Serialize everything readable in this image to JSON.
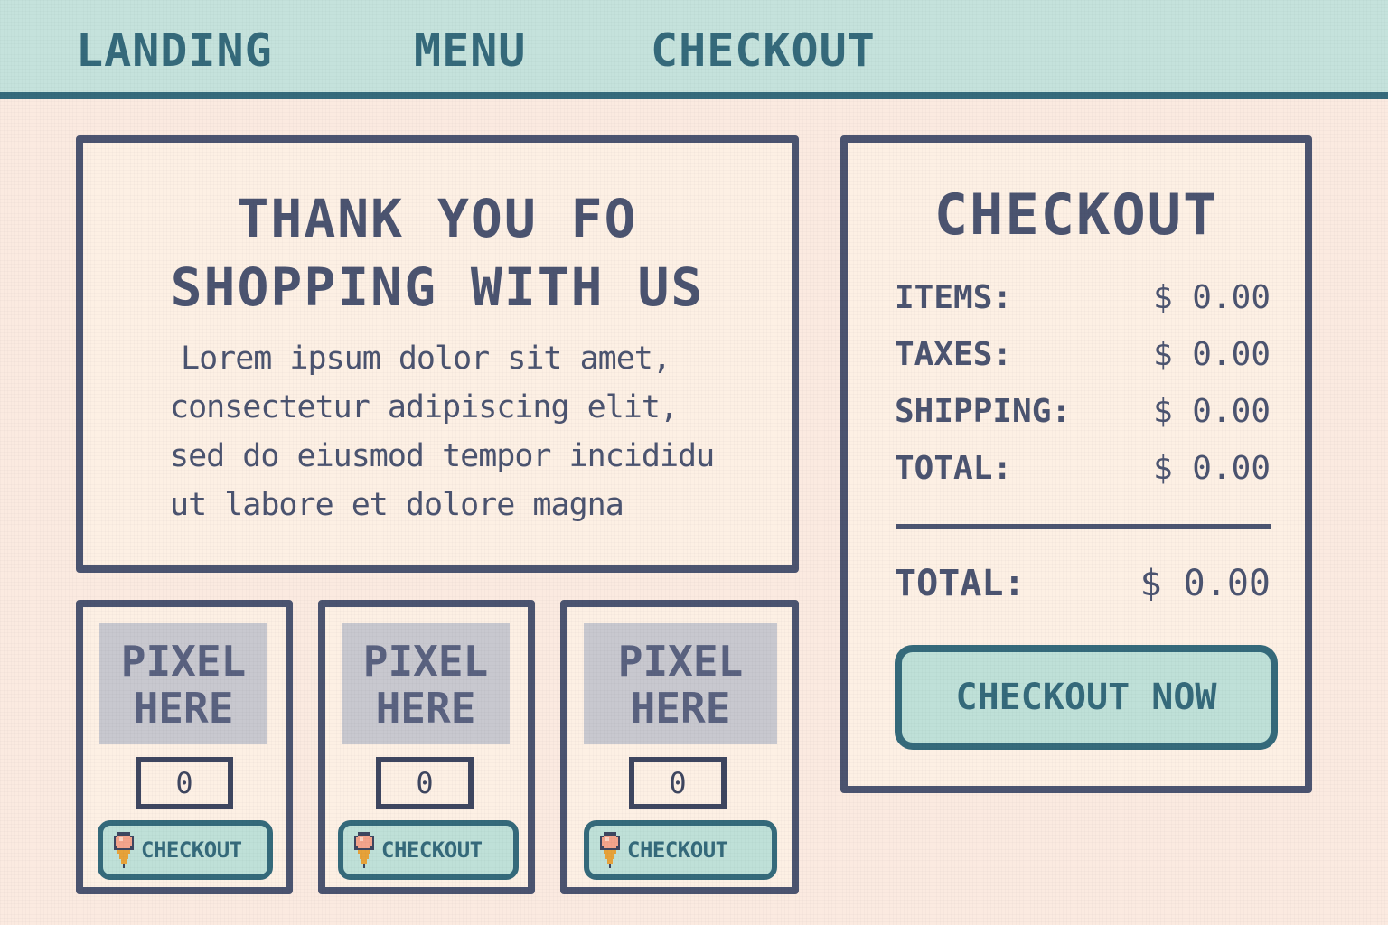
{
  "nav": {
    "items": [
      {
        "label": "LANDING"
      },
      {
        "label": "MENU"
      },
      {
        "label": "CHECKOUT"
      }
    ]
  },
  "thanks": {
    "title_line1": "THANK YOU FO",
    "title_line2": "SHOPPING WITH US",
    "body_lines": [
      "Lorem ipsum dolor sit amet,",
      "consectetur adipiscing elit,",
      "sed do eiusmod tempor incididu",
      "ut labore et dolore magna"
    ]
  },
  "products": [
    {
      "placeholder_line1": "PIXEL",
      "placeholder_line2": "HERE",
      "quantity": "0",
      "button_label": "CHECKOUT",
      "icon": "ice-cream-icon"
    },
    {
      "placeholder_line1": "PIXEL",
      "placeholder_line2": "HERE",
      "quantity": "0",
      "button_label": "CHECKOUT",
      "icon": "ice-cream-icon"
    },
    {
      "placeholder_line1": "PIXEL",
      "placeholder_line2": "HERE",
      "quantity": "0",
      "button_label": "CHECKOUT",
      "icon": "ice-cream-icon"
    }
  ],
  "summary": {
    "title": "CHECKOUT",
    "rows": [
      {
        "label": "ITEMS:",
        "value": "$ 0.00"
      },
      {
        "label": "TAXES:",
        "value": "$ 0.00"
      },
      {
        "label": "SHIPPING:",
        "value": "$ 0.00"
      },
      {
        "label": "TOTAL:",
        "value": "$ 0.00"
      }
    ],
    "grand_total": {
      "label": "TOTAL:",
      "value": "$ 0.00"
    },
    "button_label": "CHECKOUT NOW"
  },
  "colors": {
    "background": "#fbeae0",
    "nav_bg": "#c5e2dc",
    "teal": "#356a7b",
    "ink": "#4b5470",
    "button_bg": "#bfe0d8",
    "placeholder_bg": "#c8c8cf"
  }
}
